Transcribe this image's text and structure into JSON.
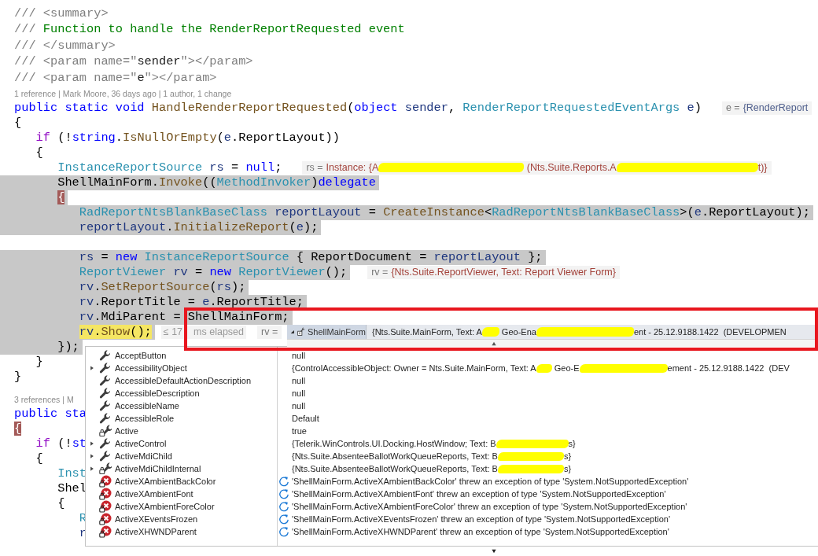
{
  "editor": {
    "lines": [
      {
        "kind": "comment",
        "selected": false,
        "current": false,
        "tokens": [
          {
            "kind": "doc",
            "text": "/// <summary>"
          }
        ]
      },
      {
        "kind": "comment",
        "selected": false,
        "current": false,
        "tokens": [
          {
            "kind": "doc",
            "text": "/// "
          },
          {
            "kind": "comment",
            "text": "Function to handle the RenderReportRequested event"
          }
        ]
      },
      {
        "kind": "comment",
        "selected": false,
        "current": false,
        "tokens": [
          {
            "kind": "doc",
            "text": "/// </summary>"
          }
        ]
      },
      {
        "kind": "comment",
        "selected": false,
        "current": false,
        "tokens": [
          {
            "kind": "doc",
            "text": "/// <param name=\""
          },
          {
            "kind": "docname",
            "text": "sender"
          },
          {
            "kind": "doc",
            "text": "\"></param>"
          }
        ]
      },
      {
        "kind": "comment",
        "selected": false,
        "current": false,
        "tokens": [
          {
            "kind": "doc",
            "text": "/// <param name=\""
          },
          {
            "kind": "docname",
            "text": "e"
          },
          {
            "kind": "doc",
            "text": "\"></param>"
          }
        ]
      },
      {
        "kind": "lens",
        "text": "1 reference | Mark Moore, 36 days ago | 1 author, 1 change"
      },
      {
        "kind": "code",
        "selected": false,
        "current": false,
        "tokens": [
          {
            "kind": "keyword",
            "text": "public static void "
          },
          {
            "kind": "method",
            "text": "HandleRenderReportRequested"
          },
          {
            "kind": "plain",
            "text": "("
          },
          {
            "kind": "keyword",
            "text": "object"
          },
          {
            "kind": "local",
            "text": " sender"
          },
          {
            "kind": "plain",
            "text": ", "
          },
          {
            "kind": "type",
            "text": "RenderReportRequestedEventArgs"
          },
          {
            "kind": "local",
            "text": " e"
          },
          {
            "kind": "plain",
            "text": ")"
          }
        ],
        "hints": [
          {
            "kind": "value",
            "name": "e =",
            "changed": false,
            "value": [
              {
                "kind": "text",
                "text": "{RenderReport"
              }
            ]
          }
        ]
      },
      {
        "kind": "code",
        "selected": false,
        "current": false,
        "tokens": [
          {
            "kind": "plain",
            "text": "{"
          }
        ]
      },
      {
        "kind": "code",
        "selected": false,
        "current": false,
        "tokens": [
          {
            "kind": "control",
            "text": "   if"
          },
          {
            "kind": "plain",
            "text": " (!"
          },
          {
            "kind": "keyword",
            "text": "string"
          },
          {
            "kind": "plain",
            "text": "."
          },
          {
            "kind": "method",
            "text": "IsNullOrEmpty"
          },
          {
            "kind": "plain",
            "text": "("
          },
          {
            "kind": "local",
            "text": "e"
          },
          {
            "kind": "plain",
            "text": ".ReportLayout))"
          }
        ]
      },
      {
        "kind": "code",
        "selected": false,
        "current": false,
        "tokens": [
          {
            "kind": "plain",
            "text": "   {"
          }
        ]
      },
      {
        "kind": "code",
        "selected": false,
        "current": false,
        "tokens": [
          {
            "kind": "type",
            "text": "      InstanceReportSource"
          },
          {
            "kind": "local",
            "text": " rs"
          },
          {
            "kind": "plain",
            "text": " = "
          },
          {
            "kind": "keyword",
            "text": "null"
          },
          {
            "kind": "plain",
            "text": ";"
          }
        ],
        "hints": [
          {
            "kind": "value",
            "name": "rs =",
            "changed": true,
            "value": [
              {
                "kind": "text",
                "text": "Instance: {A"
              },
              {
                "kind": "redaction"
              },
              {
                "kind": "text",
                "text": " (Nts.Suite.Reports.A"
              },
              {
                "kind": "redaction"
              },
              {
                "kind": "text",
                "text": "t)}"
              }
            ]
          }
        ]
      },
      {
        "kind": "code",
        "selected": true,
        "current": false,
        "tokens": [
          {
            "kind": "plain",
            "text": "      ShellMainForm."
          },
          {
            "kind": "method",
            "text": "Invoke"
          },
          {
            "kind": "plain",
            "text": "(("
          },
          {
            "kind": "type",
            "text": "MethodInvoker"
          },
          {
            "kind": "plain",
            "text": ")"
          },
          {
            "kind": "keyword",
            "text": "delegate"
          }
        ]
      },
      {
        "kind": "code",
        "selected": true,
        "current": false,
        "tokens": [
          {
            "kind": "brace",
            "text": "      {"
          }
        ]
      },
      {
        "kind": "code",
        "selected": true,
        "current": false,
        "tokens": [
          {
            "kind": "type",
            "text": "         RadReportNtsBlankBaseClass"
          },
          {
            "kind": "local",
            "text": " reportLayout"
          },
          {
            "kind": "plain",
            "text": " = "
          },
          {
            "kind": "method",
            "text": "CreateInstance"
          },
          {
            "kind": "plain",
            "text": "<"
          },
          {
            "kind": "type",
            "text": "RadReportNtsBlankBaseClass"
          },
          {
            "kind": "plain",
            "text": ">("
          },
          {
            "kind": "local",
            "text": "e"
          },
          {
            "kind": "plain",
            "text": ".ReportLayout);"
          }
        ]
      },
      {
        "kind": "code",
        "selected": true,
        "current": false,
        "tokens": [
          {
            "kind": "local",
            "text": "         reportLayout"
          },
          {
            "kind": "plain",
            "text": "."
          },
          {
            "kind": "method",
            "text": "InitializeReport"
          },
          {
            "kind": "plain",
            "text": "("
          },
          {
            "kind": "local",
            "text": "e"
          },
          {
            "kind": "plain",
            "text": ");"
          }
        ]
      },
      {
        "kind": "blank"
      },
      {
        "kind": "code",
        "selected": true,
        "current": false,
        "tokens": [
          {
            "kind": "local",
            "text": "         rs"
          },
          {
            "kind": "plain",
            "text": " = "
          },
          {
            "kind": "keyword",
            "text": "new "
          },
          {
            "kind": "type",
            "text": "InstanceReportSource"
          },
          {
            "kind": "plain",
            "text": " { ReportDocument = "
          },
          {
            "kind": "local",
            "text": "reportLayout"
          },
          {
            "kind": "plain",
            "text": " };"
          }
        ]
      },
      {
        "kind": "code",
        "selected": true,
        "current": false,
        "tokens": [
          {
            "kind": "type",
            "text": "         ReportViewer"
          },
          {
            "kind": "local",
            "text": " rv"
          },
          {
            "kind": "plain",
            "text": " = "
          },
          {
            "kind": "keyword",
            "text": "new "
          },
          {
            "kind": "type",
            "text": "ReportViewer"
          },
          {
            "kind": "plain",
            "text": "();"
          }
        ],
        "hints": [
          {
            "kind": "value",
            "name": "rv =",
            "changed": true,
            "value": [
              {
                "kind": "text",
                "text": "{Nts.Suite.ReportViewer, Text: Report Viewer Form}"
              }
            ]
          }
        ]
      },
      {
        "kind": "code",
        "selected": true,
        "current": false,
        "tokens": [
          {
            "kind": "local",
            "text": "         rv"
          },
          {
            "kind": "plain",
            "text": "."
          },
          {
            "kind": "method",
            "text": "SetReportSource"
          },
          {
            "kind": "plain",
            "text": "("
          },
          {
            "kind": "local",
            "text": "rs"
          },
          {
            "kind": "plain",
            "text": ");"
          }
        ]
      },
      {
        "kind": "code",
        "selected": true,
        "current": false,
        "tokens": [
          {
            "kind": "local",
            "text": "         rv"
          },
          {
            "kind": "plain",
            "text": ".ReportTitle = "
          },
          {
            "kind": "local",
            "text": "e"
          },
          {
            "kind": "plain",
            "text": ".ReportTitle;"
          }
        ]
      },
      {
        "kind": "code",
        "selected": true,
        "current": false,
        "tokens": [
          {
            "kind": "local",
            "text": "         rv"
          },
          {
            "kind": "plain",
            "text": ".MdiParent = ShellMainForm;"
          }
        ]
      },
      {
        "kind": "code",
        "selected": true,
        "current": true,
        "tokens": [
          {
            "kind": "local",
            "text": "         rv"
          },
          {
            "kind": "plain",
            "text": "."
          },
          {
            "kind": "method",
            "text": "Show"
          },
          {
            "kind": "plain",
            "text": "();"
          }
        ],
        "hints": [
          {
            "kind": "timing",
            "parts": [
              "≤ 17",
              "ms elapsed"
            ]
          },
          {
            "kind": "value",
            "name": "rv ="
          }
        ]
      },
      {
        "kind": "code",
        "selected": true,
        "current": false,
        "tokens": [
          {
            "kind": "plain",
            "text": "      });"
          }
        ]
      },
      {
        "kind": "code",
        "selected": false,
        "current": false,
        "tokens": [
          {
            "kind": "plain",
            "text": "   }"
          }
        ]
      },
      {
        "kind": "code",
        "selected": false,
        "current": false,
        "tokens": [
          {
            "kind": "plain",
            "text": "}"
          }
        ]
      },
      {
        "kind": "lens",
        "text": "3 references | M"
      },
      {
        "kind": "code",
        "selected": false,
        "current": false,
        "tokens": [
          {
            "kind": "keyword",
            "text": "public sta"
          }
        ]
      },
      {
        "kind": "code",
        "selected": false,
        "current": false,
        "tokens": [
          {
            "kind": "brace",
            "text": "{"
          }
        ]
      },
      {
        "kind": "code",
        "selected": false,
        "current": false,
        "tokens": [
          {
            "kind": "control",
            "text": "   if"
          },
          {
            "kind": "plain",
            "text": " (!"
          },
          {
            "kind": "keyword",
            "text": "st"
          }
        ]
      },
      {
        "kind": "code",
        "selected": false,
        "current": false,
        "tokens": [
          {
            "kind": "plain",
            "text": "   {"
          }
        ]
      },
      {
        "kind": "code",
        "selected": false,
        "current": false,
        "tokens": [
          {
            "kind": "type",
            "text": "      Inst"
          }
        ]
      },
      {
        "kind": "code",
        "selected": false,
        "current": false,
        "tokens": [
          {
            "kind": "plain",
            "text": "      Shel"
          }
        ]
      },
      {
        "kind": "code",
        "selected": false,
        "current": false,
        "tokens": [
          {
            "kind": "plain",
            "text": "      {"
          }
        ]
      },
      {
        "kind": "code",
        "selected": false,
        "current": false,
        "tokens": [
          {
            "kind": "type",
            "text": "         R"
          }
        ]
      },
      {
        "kind": "code",
        "selected": false,
        "current": false,
        "tokens": [
          {
            "kind": "local",
            "text": "         r"
          }
        ]
      }
    ]
  },
  "datatip": {
    "expanded": true,
    "name": "ShellMainForm",
    "value": [
      {
        "kind": "text",
        "text": "{Nts.Suite.MainForm, Text: A"
      },
      {
        "kind": "redaction"
      },
      {
        "kind": "text",
        "text": " Geo-Ena"
      },
      {
        "kind": "redaction"
      },
      {
        "kind": "text",
        "text": "ent - 25.12.9188.1422  (DEVELOPMEN"
      }
    ]
  },
  "members": [
    {
      "kind": "property",
      "name": "AcceptButton",
      "expandable": false,
      "value": [
        {
          "kind": "text",
          "text": "null"
        }
      ]
    },
    {
      "kind": "property",
      "name": "AccessibilityObject",
      "expandable": true,
      "value": [
        {
          "kind": "text",
          "text": "{ControlAccessibleObject: Owner = Nts.Suite.MainForm, Text: A"
        },
        {
          "kind": "redaction"
        },
        {
          "kind": "text",
          "text": " Geo-E"
        },
        {
          "kind": "redaction"
        },
        {
          "kind": "text",
          "text": "ement - 25.12.9188.1422  (DEV"
        }
      ]
    },
    {
      "kind": "property",
      "name": "AccessibleDefaultActionDescription",
      "expandable": false,
      "value": [
        {
          "kind": "text",
          "text": "null"
        }
      ]
    },
    {
      "kind": "property",
      "name": "AccessibleDescription",
      "expandable": false,
      "value": [
        {
          "kind": "text",
          "text": "null"
        }
      ]
    },
    {
      "kind": "property",
      "name": "AccessibleName",
      "expandable": false,
      "value": [
        {
          "kind": "text",
          "text": "null"
        }
      ]
    },
    {
      "kind": "property",
      "name": "AccessibleRole",
      "expandable": false,
      "value": [
        {
          "kind": "text",
          "text": "Default"
        }
      ]
    },
    {
      "kind": "private",
      "name": "Active",
      "expandable": false,
      "value": [
        {
          "kind": "text",
          "text": "true"
        }
      ]
    },
    {
      "kind": "property",
      "name": "ActiveControl",
      "expandable": true,
      "value": [
        {
          "kind": "text",
          "text": "{Telerik.WinControls.UI.Docking.HostWindow; Text: B"
        },
        {
          "kind": "redaction"
        },
        {
          "kind": "text",
          "text": "s}"
        }
      ]
    },
    {
      "kind": "property",
      "name": "ActiveMdiChild",
      "expandable": true,
      "value": [
        {
          "kind": "text",
          "text": "{Nts.Suite.AbsenteeBallotWorkQueueReports, Text: B"
        },
        {
          "kind": "redaction"
        },
        {
          "kind": "text",
          "text": "s}"
        }
      ]
    },
    {
      "kind": "private",
      "name": "ActiveMdiChildInternal",
      "expandable": true,
      "value": [
        {
          "kind": "text",
          "text": "{Nts.Suite.AbsenteeBallotWorkQueueReports, Text: B"
        },
        {
          "kind": "redaction"
        },
        {
          "kind": "text",
          "text": "s}"
        }
      ]
    },
    {
      "kind": "error",
      "name": "ActiveXAmbientBackColor",
      "expandable": false,
      "value": [
        {
          "kind": "text",
          "text": "'ShellMainForm.ActiveXAmbientBackColor' threw an exception of type 'System.NotSupportedException'"
        }
      ]
    },
    {
      "kind": "error",
      "name": "ActiveXAmbientFont",
      "expandable": false,
      "value": [
        {
          "kind": "text",
          "text": "'ShellMainForm.ActiveXAmbientFont' threw an exception of type 'System.NotSupportedException'"
        }
      ]
    },
    {
      "kind": "error",
      "name": "ActiveXAmbientForeColor",
      "expandable": false,
      "value": [
        {
          "kind": "text",
          "text": "'ShellMainForm.ActiveXAmbientForeColor' threw an exception of type 'System.NotSupportedException'"
        }
      ]
    },
    {
      "kind": "error",
      "name": "ActiveXEventsFrozen",
      "expandable": false,
      "value": [
        {
          "kind": "text",
          "text": "'ShellMainForm.ActiveXEventsFrozen' threw an exception of type 'System.NotSupportedException'"
        }
      ]
    },
    {
      "kind": "error",
      "name": "ActiveXHWNDParent",
      "expandable": false,
      "value": [
        {
          "kind": "text",
          "text": "'ShellMainForm.ActiveXHWNDParent' threw an exception of type 'System.NotSupportedException'"
        }
      ]
    }
  ],
  "annotation": {
    "shown": true
  }
}
